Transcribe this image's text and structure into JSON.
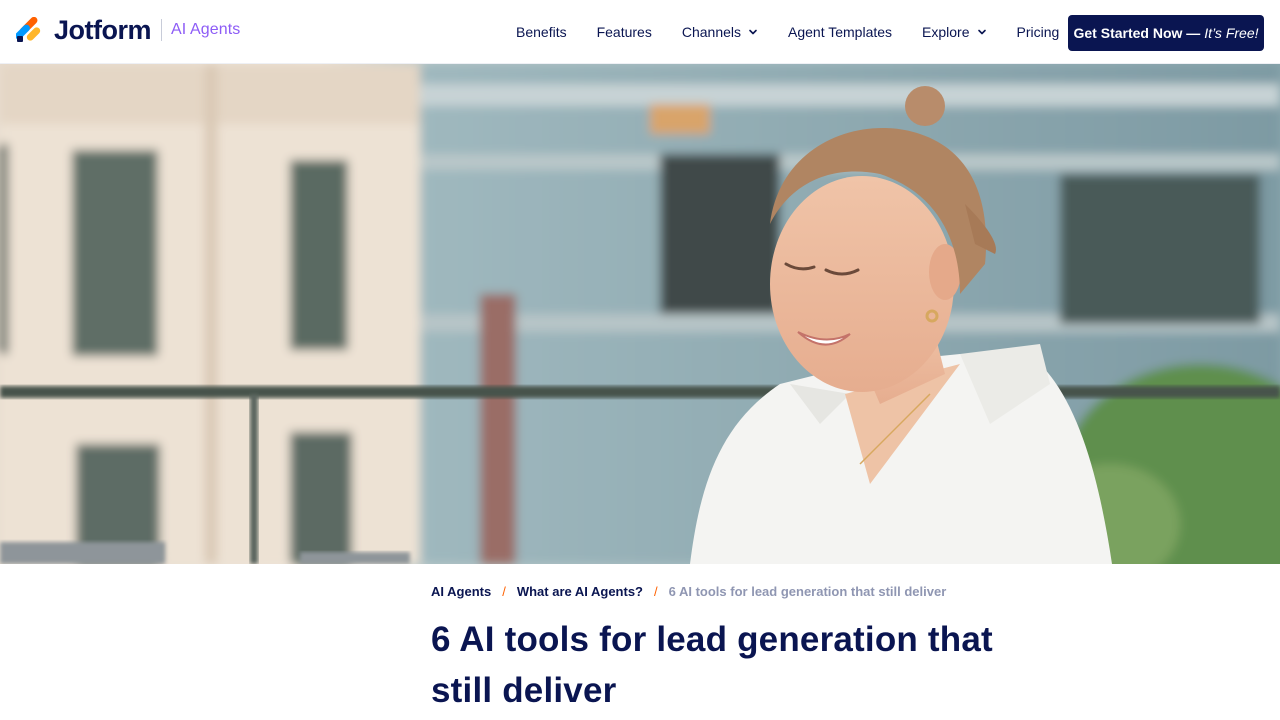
{
  "header": {
    "brand_name": "Jotform",
    "product_name": "AI Agents",
    "nav": [
      {
        "label": "Benefits",
        "has_dropdown": false
      },
      {
        "label": "Features",
        "has_dropdown": false
      },
      {
        "label": "Channels",
        "has_dropdown": true
      },
      {
        "label": "Agent Templates",
        "has_dropdown": false
      },
      {
        "label": "Explore",
        "has_dropdown": true
      },
      {
        "label": "Pricing",
        "has_dropdown": false
      }
    ],
    "cta": {
      "label": "Get Started Now —",
      "label_suffix": "It’s Free!"
    }
  },
  "hero": {
    "icon": "hero-photo",
    "colors": {
      "sky": "#a9bfc4",
      "building": "#efe5d9",
      "shirt": "#f6f6f4",
      "hair": "#b88c6b",
      "foliage": "#5f8f4e"
    }
  },
  "article": {
    "breadcrumb": [
      {
        "label": "AI Agents",
        "link": true
      },
      {
        "label": "What are AI Agents?",
        "link": true
      },
      {
        "label": "6 AI tools for lead generation that still deliver",
        "link": false
      }
    ],
    "title_line1": "6 AI tools for lead generation that",
    "title_line2": "still deliver"
  },
  "colors": {
    "navy": "#0a1551",
    "accent_orange": "#ff6100",
    "accent_purple": "#8d5cf6",
    "muted": "#8f96b2"
  }
}
